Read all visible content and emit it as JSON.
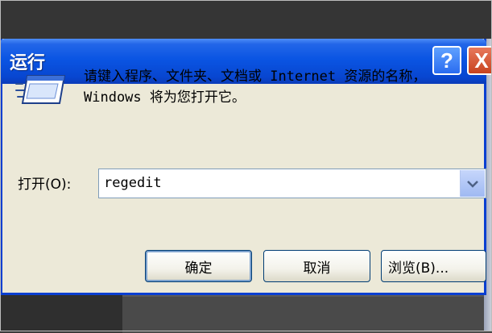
{
  "dialog": {
    "title": "运行",
    "help_glyph": "?",
    "close_glyph": "X",
    "description": "请键入程序、文件夹、文档或 Internet 资源的名称，Windows 将为您打开它。",
    "open_label": "打开(O):",
    "command_value": "regedit",
    "buttons": {
      "ok": "确定",
      "cancel": "取消",
      "browse": "浏览(B)..."
    }
  },
  "icons": {
    "run": "run-icon",
    "dropdown": "chevron-down-icon"
  },
  "colors": {
    "titlebar": "#0a55e3",
    "dialog_bg": "#ece9d8",
    "close_red": "#c8431f",
    "frame_blue": "#0a3fd1"
  }
}
